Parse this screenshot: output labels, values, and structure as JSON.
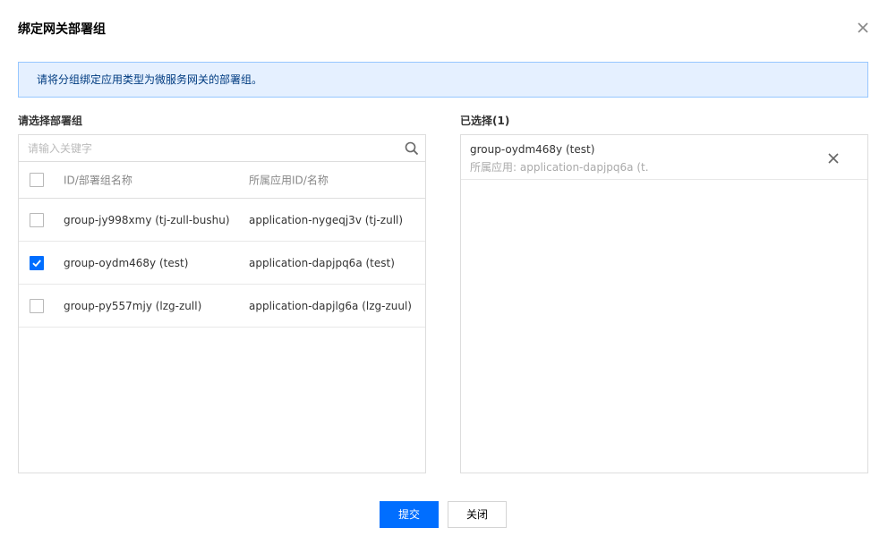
{
  "dialog": {
    "title": "绑定网关部署组",
    "notice": "请将分组绑定应用类型为微服务网关的部署组。"
  },
  "left_panel": {
    "label": "请选择部署组",
    "search_placeholder": "请输入关键字",
    "columns": {
      "id": "ID/部署组名称",
      "app": "所属应用ID/名称"
    },
    "rows": [
      {
        "id": "group-jy998xmy (tj-zull-bushu)",
        "app": "application-nygeqj3v (tj-zull)",
        "checked": false
      },
      {
        "id": "group-oydm468y (test)",
        "app": "application-dapjpq6a (test)",
        "checked": true
      },
      {
        "id": "group-py557mjy (lzg-zull)",
        "app": "application-dapjlg6a (lzg-zuul)",
        "checked": false
      }
    ]
  },
  "right_panel": {
    "label": "已选择(1)",
    "items": [
      {
        "name": "group-oydm468y (test)",
        "app": "所属应用: application-dapjpq6a (t..."
      }
    ]
  },
  "buttons": {
    "submit": "提交",
    "close": "关闭"
  },
  "colors": {
    "primary": "#006eff",
    "notice_bg": "#e5f0ff",
    "notice_border": "#97c7ff"
  }
}
